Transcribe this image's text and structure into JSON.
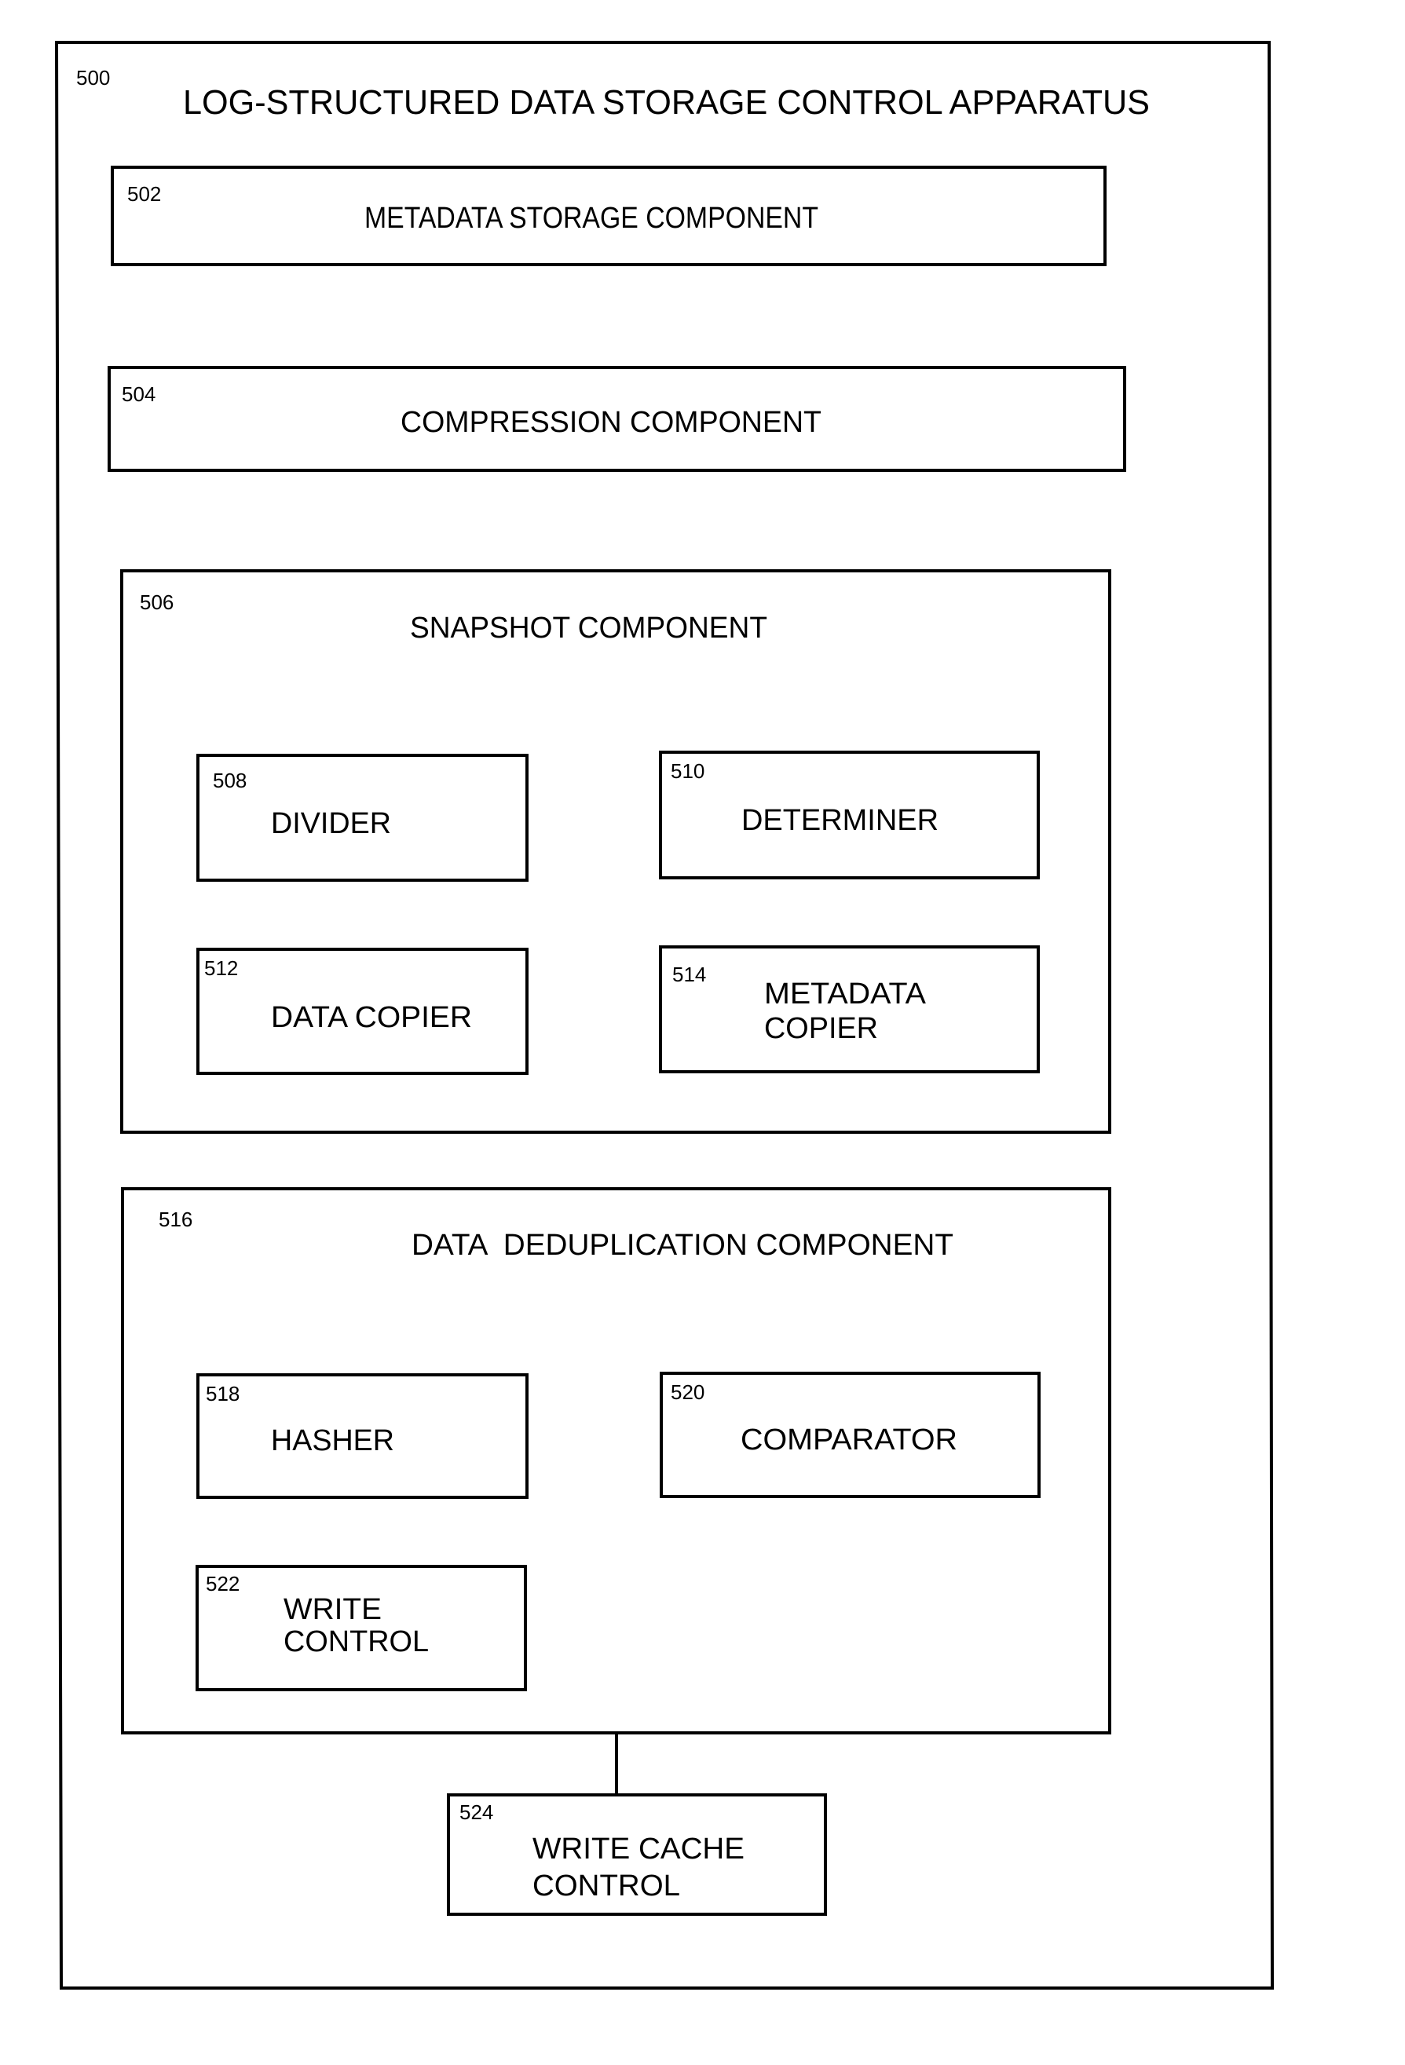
{
  "diagram": {
    "apparatus": {
      "ref": "500",
      "title": "LOG-STRUCTURED DATA STORAGE CONTROL APPARATUS"
    },
    "components": {
      "metadata_storage": {
        "ref": "502",
        "label": "METADATA STORAGE COMPONENT"
      },
      "compression": {
        "ref": "504",
        "label": "COMPRESSION COMPONENT"
      },
      "snapshot": {
        "ref": "506",
        "label": "SNAPSHOT COMPONENT",
        "children": {
          "divider": {
            "ref": "508",
            "label": [
              "DIVIDER"
            ]
          },
          "determiner": {
            "ref": "510",
            "label": [
              "DETERMINER"
            ]
          },
          "data_copier": {
            "ref": "512",
            "label": [
              "DATA COPIER"
            ]
          },
          "metadata_copier": {
            "ref": "514",
            "label": [
              "METADATA",
              "COPIER"
            ]
          }
        }
      },
      "data_deduplication": {
        "ref": "516",
        "label": "DATA  DEDUPLICATION COMPONENT",
        "children": {
          "hasher": {
            "ref": "518",
            "label": [
              "HASHER"
            ]
          },
          "comparator": {
            "ref": "520",
            "label": [
              "COMPARATOR"
            ]
          },
          "write_control": {
            "ref": "522",
            "label": [
              "WRITE",
              "CONTROL"
            ]
          }
        }
      },
      "write_cache_control": {
        "ref": "524",
        "label": [
          "WRITE CACHE",
          "CONTROL"
        ]
      }
    },
    "connections": [
      {
        "from": "516",
        "to": "524"
      }
    ]
  }
}
